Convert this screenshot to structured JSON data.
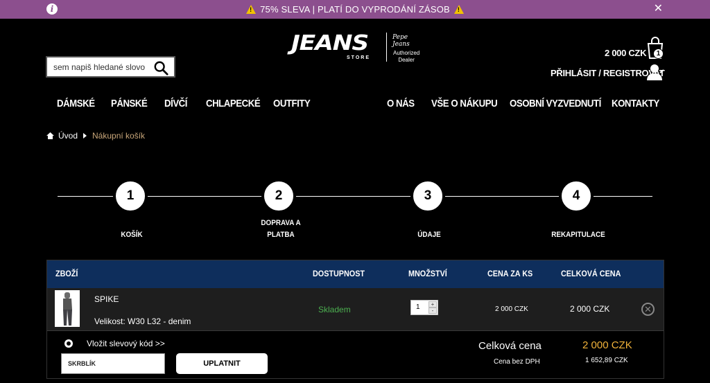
{
  "promo": {
    "text": "75% SLEVA | PLATÍ DO VYPRODÁNÍ ZÁSOB",
    "info_glyph": "i",
    "close_glyph": "✕",
    "icons": [
      "info-icon",
      "warning-icon",
      "close-icon"
    ]
  },
  "search": {
    "placeholder": "sem napiš hledané slovo"
  },
  "logo": {
    "main": "JEANS",
    "sub": "STORE",
    "partner": "Pepe Jeans",
    "auth_line1": "Authorized",
    "auth_line2": "Dealer"
  },
  "account": {
    "cart_total": "2 000 CZK",
    "cart_count": "1",
    "login_label": "PŘIHLÁSIT / REGISTROVAT"
  },
  "nav": {
    "left": [
      "DÁMSKÉ",
      "PÁNSKÉ",
      "DÍVČÍ",
      "CHLAPECKÉ",
      "OUTFITY"
    ],
    "right": [
      "O NÁS",
      "VŠE O NÁKUPU",
      "OSOBNÍ VYZVEDNUTÍ",
      "KONTAKTY"
    ]
  },
  "breadcrumb": {
    "home": "Úvod",
    "current": "Nákupní košík"
  },
  "steps": [
    {
      "number": "1",
      "label_line1": "KOŠÍK",
      "label_line2": ""
    },
    {
      "number": "2",
      "label_line1": "DOPRAVA A",
      "label_line2": "PLATBA"
    },
    {
      "number": "3",
      "label_line1": "ÚDAJE",
      "label_line2": ""
    },
    {
      "number": "4",
      "label_line1": "REKAPITULACE",
      "label_line2": ""
    }
  ],
  "table": {
    "headers": {
      "product": "ZBOŽÍ",
      "availability": "DOSTUPNOST",
      "quantity": "MNOŽSTVÍ",
      "unit_price": "CENA ZA KS",
      "total_price": "CELKOVÁ CENA"
    },
    "rows": [
      {
        "name": "SPIKE",
        "size": "Velikost: W30 L32 - denim",
        "availability": "Skladem",
        "quantity": "1",
        "unit_price": "2 000 CZK",
        "total_price": "2 000 CZK"
      }
    ],
    "qty_up": "+",
    "qty_down": "-",
    "remove_glyph": "✕"
  },
  "voucher": {
    "label": "Vložit slevový kód >>",
    "code_value": "SKRBLÍK",
    "apply_label": "UPLATNIT"
  },
  "summary": {
    "total_label": "Celková cena",
    "total_value": "2 000 CZK",
    "net_label": "Cena bez DPH",
    "net_value": "1 652,89 CZK"
  },
  "colors": {
    "promo_bg": "#8c4f8e",
    "table_header_bg": "#0e2e5c",
    "stock_green": "#4caf50",
    "total_accent": "#f2b33a",
    "breadcrumb_current": "#c9a77a"
  }
}
